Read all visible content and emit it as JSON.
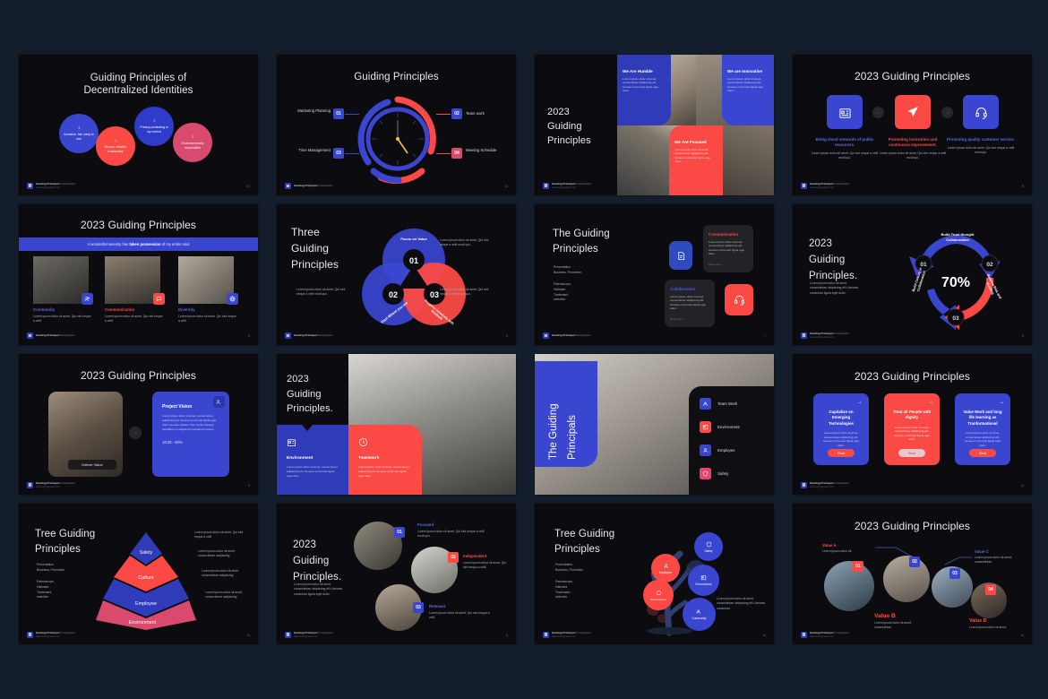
{
  "page": {
    "background": "#141d2b",
    "slide_background": "#0c0c10",
    "accent_blue": "#3a46cf",
    "accent_blue_light": "#4b58e0",
    "accent_red": "#fb4a45",
    "accent_pink": "#d94a6e"
  },
  "footer": {
    "brand": "Guiding Principal",
    "brand_rest": " Presentation",
    "sub": "www.reallygreatsite.com"
  },
  "lorem": {
    "short": "Lorem ipsum dolor sit amet, Qui sint nequa a velit.",
    "medium": "Lorem ipsum dolor sit amet, consectetuer adipiscing elit. Aenean commodo ligula eget dolor.",
    "long": "Lorem ipsum dolor sit amet, consectetuer adipiscing elit. Aenean commodo ligula eget dolor. Aenean massa. Cum sociis natoque penatibus et magnis dis parturient montes.",
    "xs": "Lorem ipsum dolor sit amet, Qui sint neque a velit modi quo."
  },
  "slides": [
    {
      "n": 1,
      "page_no": "01",
      "title_line1": "Guiding Principles of",
      "title_line2": "Decentralized Identities",
      "bubbles": [
        {
          "label": "Inclusive, fair, easy to use",
          "color": "#3a46cf"
        },
        {
          "label": "Secure, reliable, trustworthy",
          "color": "#fb4a45"
        },
        {
          "label": "Privacy protecting in my control",
          "color": "#2f3bc9"
        },
        {
          "label": "Environmentally responsible",
          "color": "#d94a6e"
        }
      ]
    },
    {
      "n": 2,
      "page_no": "11",
      "title": "Guiding Principles",
      "items": [
        {
          "num": "01",
          "label": "Marketing Planning",
          "color": "#3a46cf",
          "side": "left"
        },
        {
          "num": "02",
          "label": "Team work",
          "color": "#3a46cf",
          "side": "right"
        },
        {
          "num": "03",
          "label": "Time Management",
          "color": "#3a46cf",
          "side": "left"
        },
        {
          "num": "04",
          "label": "Meeting Schedule",
          "color": "#d94a6e",
          "side": "right"
        }
      ]
    },
    {
      "n": 3,
      "page_no": "04",
      "title_lines": [
        "2023",
        "Guiding",
        "Principles"
      ],
      "panels": [
        {
          "heading": "We Are Humble",
          "color": "#2f3bb8"
        },
        {
          "heading": "We are Innovative",
          "color": "#3a46cf"
        },
        {
          "heading": "We Are Focused",
          "color": "#fb4a45"
        }
      ]
    },
    {
      "n": 4,
      "page_no": "5",
      "title": "2023 Guiding Principles",
      "cards": [
        {
          "icon": "building-icon",
          "heading": "Being Good stewards of public resources.",
          "color": "#3a46cf",
          "head_color": "#5b6bdc"
        },
        {
          "icon": "send-icon",
          "heading": "Promoting innovation and continuous improvement.",
          "color": "#fb4a45",
          "head_color": "#fb4a45"
        },
        {
          "icon": "headset-icon",
          "heading": "Promoting quality customer service.",
          "color": "#3a46cf",
          "head_color": "#5b6bdc"
        }
      ],
      "body": "Lorem ipsum dolor sit amet. Qui sint neque a velit modi qui."
    },
    {
      "n": 5,
      "page_no": "6",
      "title": "2023 Guiding Principles",
      "banner_pre": "A wonderful serenity has ",
      "banner_bold": "taken possession",
      "banner_post": " of my entire soul",
      "columns": [
        {
          "label": "Community",
          "color": "#5b6bdc",
          "icon": "people-icon",
          "icon_bg": "#3a46cf"
        },
        {
          "label": "Communication",
          "color": "#fb4a45",
          "icon": "chat-icon",
          "icon_bg": "#fb4a45"
        },
        {
          "label": "Diversity",
          "color": "#5b6bdc",
          "icon": "globe-icon",
          "icon_bg": "#3a46cf"
        }
      ],
      "body": "Lorem ipsum dolor sit amet. Qui sint neque a velit"
    },
    {
      "n": 6,
      "page_no": "4",
      "title_lines": [
        "Three",
        "Guiding",
        "Principles"
      ],
      "rings": [
        {
          "num": "01",
          "label": "Focus on Value",
          "color": "#3a46cf"
        },
        {
          "num": "02",
          "label": "Start Where you are",
          "color": "#3a46cf"
        },
        {
          "num": "03",
          "label": "Progress iteratively with feedback",
          "color": "#fb4a45"
        }
      ]
    },
    {
      "n": 7,
      "page_no": "7",
      "title_lines": [
        "The Guiding",
        "Principles"
      ],
      "meta": [
        "Presentation",
        "Business, Promotion"
      ],
      "meta2": [
        "Patentscope,",
        "Hallmark",
        "Trademark",
        "selective"
      ],
      "tiles": [
        {
          "heading": "Communication",
          "color": "#fb4a45",
          "link": "Read more →"
        },
        {
          "heading": "Collaboration",
          "color": "#4b58e0",
          "link": "Read more →"
        }
      ],
      "icons": [
        "document-icon",
        "headset-icon"
      ]
    },
    {
      "n": 8,
      "page_no": "8",
      "title_lines": [
        "2023",
        "Guiding",
        "Principles."
      ],
      "percent": "70%",
      "arcs": [
        {
          "num": "01",
          "label": "Build Culture of Collaboration",
          "color": "#3a46cf"
        },
        {
          "num": "02",
          "label": "Build Trust thought Collaboration",
          "color": "#3a46cf"
        },
        {
          "num": "03",
          "label": "Balance Risk and Funding",
          "color": "#fb4a45"
        }
      ]
    },
    {
      "n": 9,
      "page_no": "9",
      "title": "2023 Guiding Principles",
      "photo_caption": "Deliver Value",
      "card_title": "Project Vision",
      "card_stat": "18:22 - 60%",
      "badge": "icon-badge"
    },
    {
      "n": 10,
      "page_no": "10",
      "title_lines": [
        "2023",
        "Guiding",
        "Principles."
      ],
      "blocks": [
        {
          "heading": "Environment",
          "color": "#2f3bb8",
          "icon": "building-icon"
        },
        {
          "heading": "Teamwork",
          "color": "#fb4a45",
          "icon": "clock-icon"
        }
      ]
    },
    {
      "n": 11,
      "page_no": "",
      "title_lines": [
        "The Guiding",
        "Principals"
      ],
      "menu": [
        {
          "label": "Team Work",
          "color": "#3a46cf",
          "icon": "people-icon"
        },
        {
          "label": "Environment",
          "color": "#fb4a45",
          "icon": "building-icon"
        },
        {
          "label": "Employee",
          "color": "#3a46cf",
          "icon": "user-icon"
        },
        {
          "label": "Safety",
          "color": "#e8456b",
          "icon": "shield-icon"
        }
      ]
    },
    {
      "n": 12,
      "page_no": "11",
      "title": "2023 Guiding Principles",
      "cards": [
        {
          "heading": "Capitalize on Emerging Technologies",
          "color": "#3a46cf",
          "btn": "Read"
        },
        {
          "heading": "Treat all People with dignity",
          "color": "#fb4a45",
          "btn": "Read"
        },
        {
          "heading": "Value Work and long life learning as Tranformational",
          "color": "#3a46cf",
          "btn": "Read"
        }
      ]
    },
    {
      "n": 13,
      "page_no": "13",
      "title_lines": [
        "Tree Guiding",
        "Principles"
      ],
      "meta": [
        "Presentation",
        "Business, Promotion"
      ],
      "meta2": [
        "Patentscope,",
        "Hallmark",
        "Trademark",
        "selective"
      ],
      "layers": [
        {
          "label": "Safety",
          "color": "#2f3bb8"
        },
        {
          "label": "Culture",
          "color": "#fb4a45"
        },
        {
          "label": "Employee",
          "color": "#2f3bb8"
        },
        {
          "label": "Environment",
          "color": "#d94a6e"
        }
      ],
      "notes": [
        "Lorem ipsum dolor sit amet, Qui sint neque a velit",
        "Lorem ipsum dolor sit amet, consectetuer adipiscing",
        "Lorem ipsum dolor sit amet, consectetuer adipiscing",
        "Lorem ipsum dolor sit amet, consectetuer adipiscing"
      ]
    },
    {
      "n": 14,
      "page_no": "5",
      "title_lines": [
        "2023",
        "Guiding",
        "Principles."
      ],
      "items": [
        {
          "num": "01",
          "label": "Focused",
          "color": "#3a46cf",
          "label_color": "#5b6bdc"
        },
        {
          "num": "02",
          "label": "Independent",
          "color": "#fb4a45",
          "label_color": "#fb4a45"
        },
        {
          "num": "03",
          "label": "Relevant",
          "color": "#3a46cf",
          "label_color": "#5b6bdc"
        }
      ]
    },
    {
      "n": 15,
      "page_no": "14",
      "title_lines": [
        "Tree Guiding",
        "Principles"
      ],
      "meta": [
        "Presentation",
        "Business, Promotion"
      ],
      "meta2": [
        "Patentscope,",
        "Hallmark",
        "Trademark",
        "selective"
      ],
      "nodes": [
        {
          "label": "Safety",
          "color": "#3a46cf"
        },
        {
          "label": "Employee",
          "color": "#fb4a45"
        },
        {
          "label": "Environment",
          "color": "#fb4a45"
        },
        {
          "label": "Community",
          "color": "#3a46cf"
        }
      ],
      "note": "Lorem ipsum dolor sit amet, consectetuer adipiscing elit. Aenean commodo"
    },
    {
      "n": 16,
      "page_no": "14",
      "title": "2023 Guiding Principles",
      "values": [
        {
          "num": "01",
          "label": "Value A",
          "color": "#fb4a45",
          "text": "Lorem ipsum dolor sit."
        },
        {
          "num": "02",
          "label": "Value B",
          "color": "#3a46cf",
          "text": "Lorem ipsum dolor sit amet, consectetuer"
        },
        {
          "num": "03",
          "label": "Value C",
          "color": "#3a46cf",
          "text": "Lorem ipsum dolor sit amet, consectetuer"
        },
        {
          "num": "04",
          "label": "Value D",
          "color": "#fb4a45",
          "text": "Lorem ipsum dolor sit amet,"
        }
      ]
    }
  ]
}
